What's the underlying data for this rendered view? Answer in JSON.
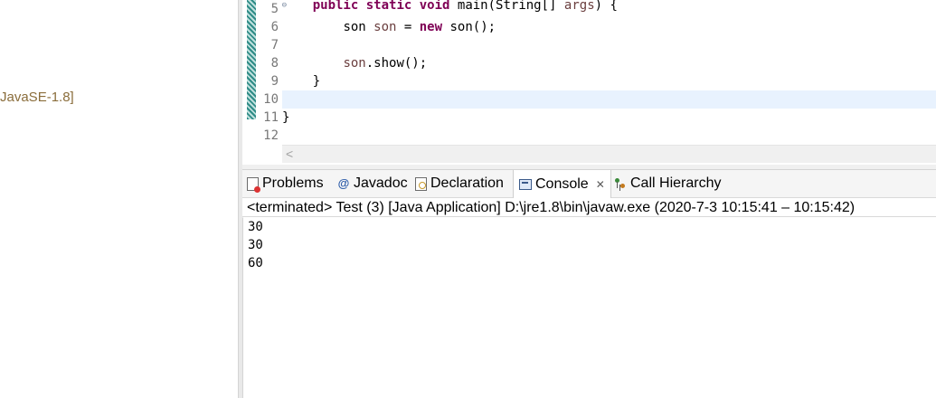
{
  "package_explorer": {
    "jre_label": "JavaSE-1.8]"
  },
  "editor": {
    "line_numbers": [
      "5",
      "6",
      "7",
      "8",
      "9",
      "10",
      "11",
      "12"
    ],
    "fold_marker": "⊖",
    "lines": {
      "l5": {
        "indent": "    ",
        "kw1": "public",
        "kw2": "static",
        "kw3": "void",
        "rest": " main(String[] ",
        "param": "args",
        "tail": ") {"
      },
      "l6": {
        "indent": "        ",
        "type": "son ",
        "var": "son",
        "eq": " = ",
        "kw": "new",
        "tail": " son();"
      },
      "l8": {
        "indent": "        ",
        "var": "son",
        "tail": ".show();"
      },
      "l9": {
        "text": "    }"
      },
      "l11": {
        "text": "}"
      }
    },
    "current_line": "10",
    "scroll_arrow": "<"
  },
  "views": {
    "tabs": [
      {
        "label": "Problems",
        "icon": "problems-icon"
      },
      {
        "label": "Javadoc",
        "icon": "javadoc-icon"
      },
      {
        "label": "Declaration",
        "icon": "declaration-icon"
      },
      {
        "label": "Console",
        "icon": "console-icon",
        "active": true,
        "close": "✕"
      },
      {
        "label": "Call Hierarchy",
        "icon": "call-hierarchy-icon"
      }
    ]
  },
  "console": {
    "status": "<terminated> Test (3) [Java Application] D:\\jre1.8\\bin\\javaw.exe  (2020-7-3 10:15:41 – 10:15:42)",
    "output": [
      "30",
      "30",
      "60"
    ]
  },
  "colors": {
    "keyword": "#7f0055",
    "variable": "#6a3e3e",
    "field": "#0000c0",
    "current_line_bg": "#e8f2fe"
  }
}
